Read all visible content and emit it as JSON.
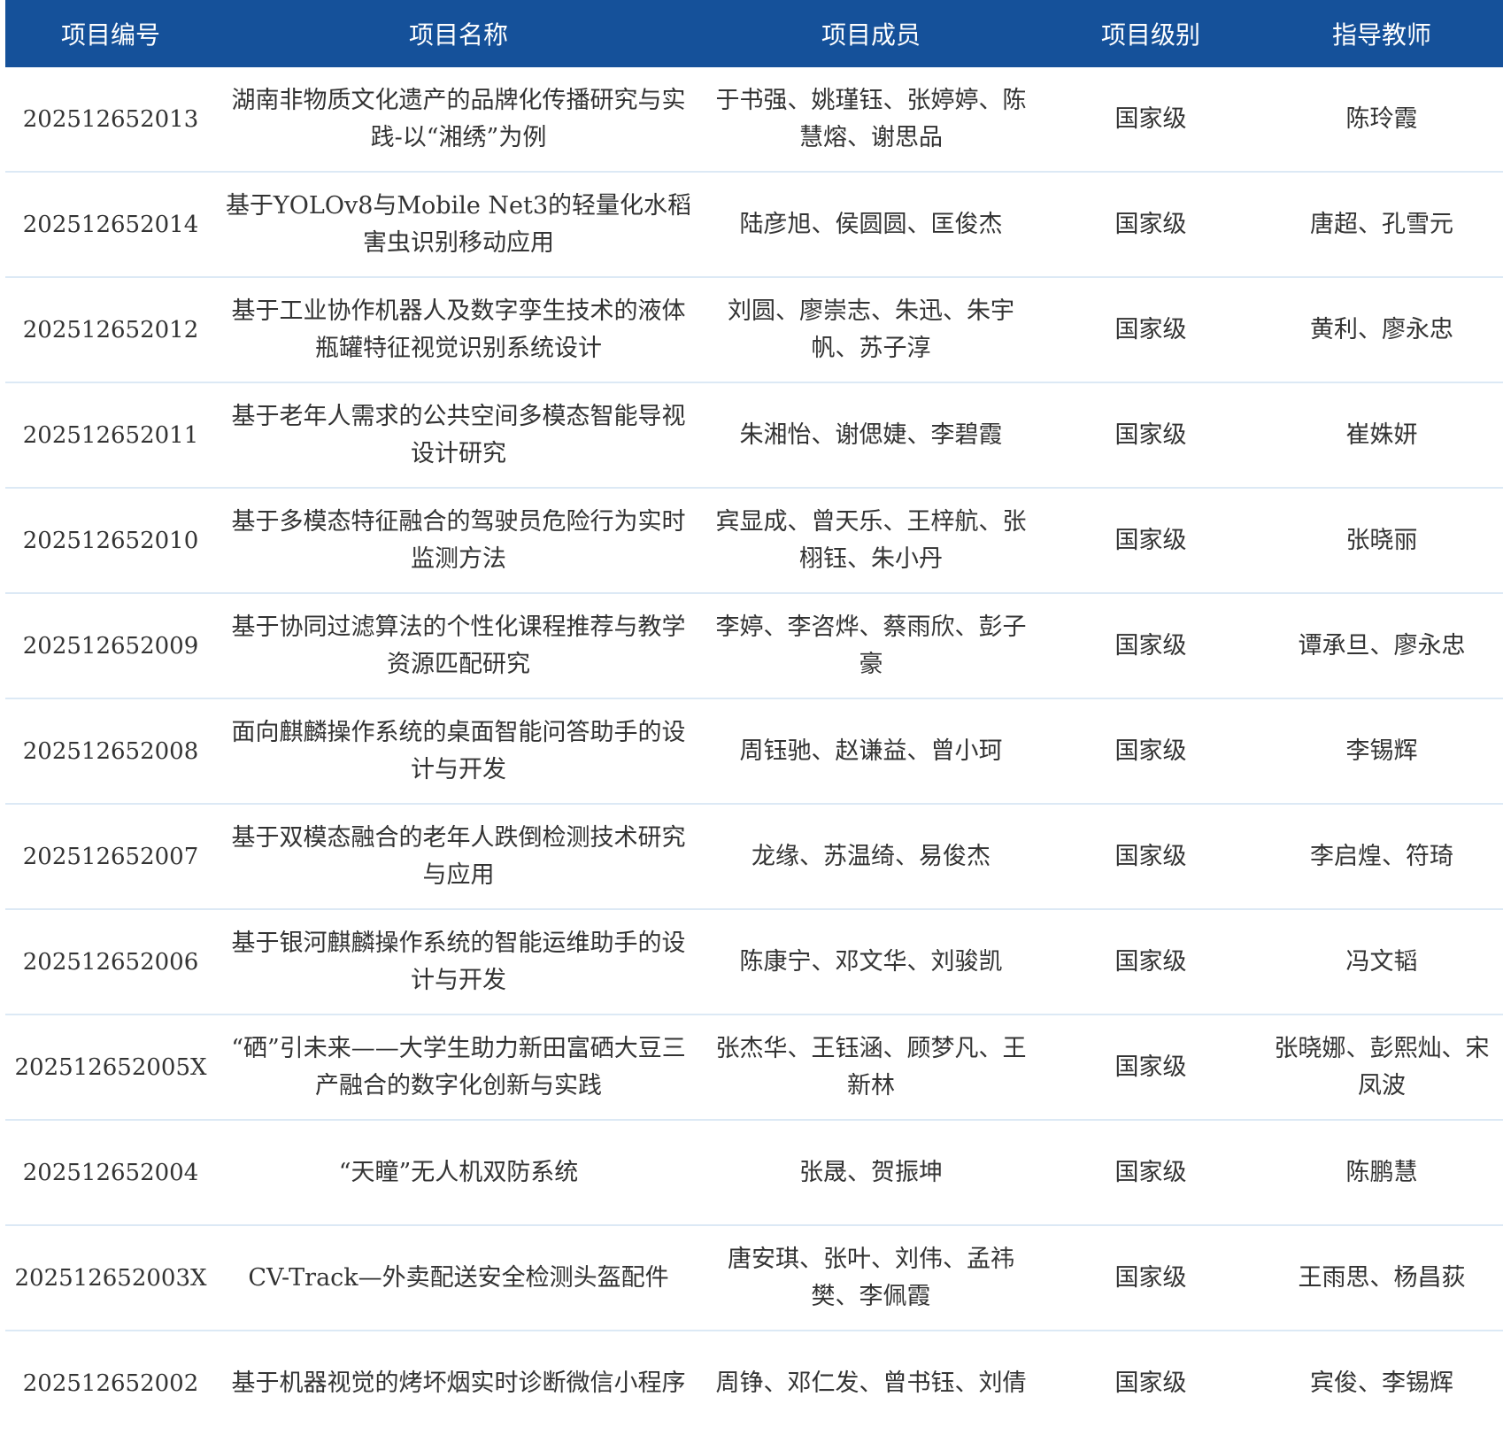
{
  "header": {
    "id": "项目编号",
    "name": "项目名称",
    "members": "项目成员",
    "level": "项目级别",
    "teacher": "指导教师"
  },
  "colors": {
    "header_bg": "#15519a",
    "header_text": "#ffffff",
    "row_divider": "#dce9f5"
  },
  "rows": [
    {
      "id": "202512652013",
      "name": "湖南非物质文化遗产的品牌化传播研究与实践-以“湘绣”为例",
      "members": "于书强、姚瑾钰、张婷婷、陈慧熔、谢思品",
      "level": "国家级",
      "teacher": "陈玲霞"
    },
    {
      "id": "202512652014",
      "name": "基于YOLOv8与Mobile Net3的轻量化水稻害虫识别移动应用",
      "members": "陆彦旭、侯圆圆、匡俊杰",
      "level": "国家级",
      "teacher": "唐超、孔雪元"
    },
    {
      "id": "202512652012",
      "name": "基于工业协作机器人及数字孪生技术的液体瓶罐特征视觉识别系统设计",
      "members": "刘圆、廖崇志、朱迅、朱宇帆、苏子淳",
      "level": "国家级",
      "teacher": "黄利、廖永忠"
    },
    {
      "id": "202512652011",
      "name": "基于老年人需求的公共空间多模态智能导视设计研究",
      "members": "朱湘怡、谢偲婕、李碧霞",
      "level": "国家级",
      "teacher": "崔姝妍"
    },
    {
      "id": "202512652010",
      "name": "基于多模态特征融合的驾驶员危险行为实时监测方法",
      "members": "宾显成、曾天乐、王梓航、张栩钰、朱小丹",
      "level": "国家级",
      "teacher": "张晓丽"
    },
    {
      "id": "202512652009",
      "name": "基于协同过滤算法的个性化课程推荐与教学资源匹配研究",
      "members": "李婷、李咨烨、蔡雨欣、彭子豪",
      "level": "国家级",
      "teacher": "谭承旦、廖永忠"
    },
    {
      "id": "202512652008",
      "name": "面向麒麟操作系统的桌面智能问答助手的设计与开发",
      "members": "周钰驰、赵谦益、曾小珂",
      "level": "国家级",
      "teacher": "李锡辉"
    },
    {
      "id": "202512652007",
      "name": "基于双模态融合的老年人跌倒检测技术研究与应用",
      "members": "龙缘、苏温绮、易俊杰",
      "level": "国家级",
      "teacher": "李启煌、符琦"
    },
    {
      "id": "202512652006",
      "name": "基于银河麒麟操作系统的智能运维助手的设计与开发",
      "members": "陈康宁、邓文华、刘骏凯",
      "level": "国家级",
      "teacher": "冯文韬"
    },
    {
      "id": "202512652005X",
      "name": "“硒”引未来——大学生助力新田富硒大豆三产融合的数字化创新与实践",
      "members": "张杰华、王钰涵、顾梦凡、王新林",
      "level": "国家级",
      "teacher": "张晓娜、彭熙灿、宋凤波"
    },
    {
      "id": "202512652004",
      "name": "“天瞳”无人机双防系统",
      "members": "张晟、贺振坤",
      "level": "国家级",
      "teacher": "陈鹏慧"
    },
    {
      "id": "202512652003X",
      "name": "CV-Track—外卖配送安全检测头盔配件",
      "members": "唐安琪、张叶、刘伟、孟祎樊、李佩霞",
      "level": "国家级",
      "teacher": "王雨思、杨昌荻"
    },
    {
      "id": "202512652002",
      "name": "基于机器视觉的烤坏烟实时诊断微信小程序",
      "members": "周铮、邓仁发、曾书钰、刘倩",
      "level": "国家级",
      "teacher": "宾俊、李锡辉"
    }
  ]
}
